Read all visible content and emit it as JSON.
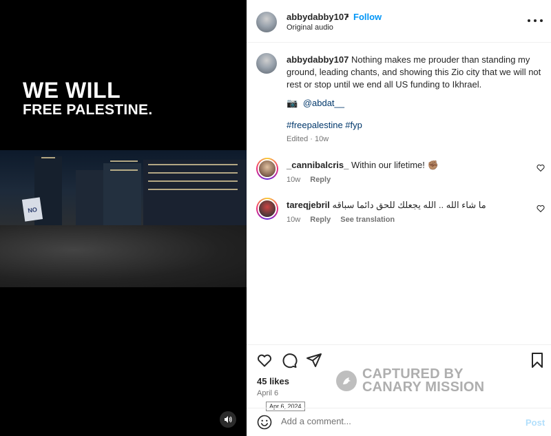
{
  "media": {
    "overlay_line1": "WE WILL",
    "overlay_line2": "FREE PALESTINE.",
    "sign_text": "NO"
  },
  "header": {
    "username": "abbydabby107",
    "dot": "•",
    "follow_label": "Follow",
    "audio_label": "Original audio"
  },
  "caption": {
    "username": "abbydabby107",
    "text": "Nothing makes me prouder than standing my ground, leading chants, and showing this Zio city that we will not rest or stop until we end all US funding to Ikhrael.",
    "camera_emoji": "📷",
    "handle": "@abdat__",
    "hashtags": "#freepalestine #fyp",
    "meta": "Edited · 10w"
  },
  "comments": [
    {
      "username": "_cannibalcris_",
      "text": "Within our lifetime! ✊🏽",
      "time": "10w",
      "reply_label": "Reply"
    },
    {
      "username": "tareqjebril",
      "text": "ما شاء الله .. الله يجعلك للحق دائما سباقه",
      "time": "10w",
      "reply_label": "Reply",
      "translate_label": "See translation"
    }
  ],
  "footer": {
    "likes": "45 likes",
    "date": "April 6",
    "date_tooltip": "Apr 6, 2024",
    "watermark_line1": "CAPTURED BY",
    "watermark_line2": "CANARY MISSION",
    "comment_placeholder": "Add a comment...",
    "post_label": "Post"
  },
  "colors": {
    "link_blue": "#0095f6",
    "hashtag": "#00376b",
    "muted": "#737373"
  },
  "icons": [
    "speaker-icon",
    "more-icon",
    "heart-icon",
    "comment-icon",
    "share-icon",
    "bookmark-icon",
    "emoji-icon"
  ]
}
